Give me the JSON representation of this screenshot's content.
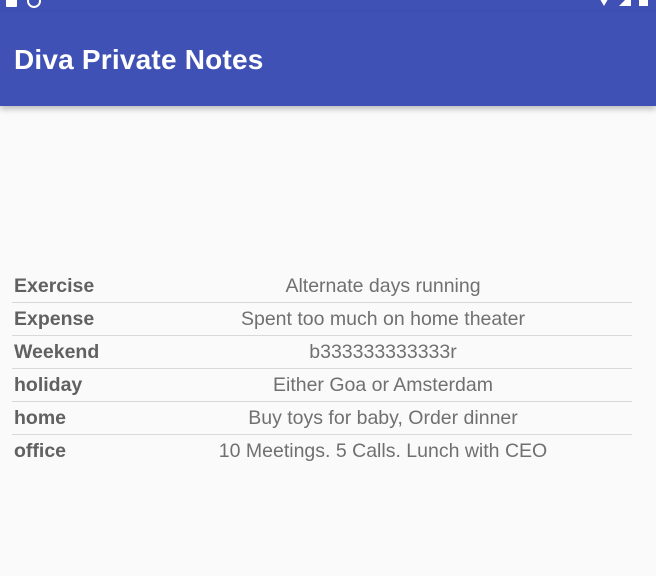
{
  "app": {
    "title": "Diva Private Notes",
    "colors": {
      "app_bar": "#3f51b5",
      "background": "#fafafa",
      "key_text": "#616161",
      "value_text": "#707070",
      "divider": "#d9d9d9"
    }
  },
  "status_bar": {
    "icons": [
      "notification-icon",
      "sync-icon",
      "wifi-icon",
      "signal-icon",
      "battery-icon"
    ]
  },
  "notes": [
    {
      "key": "Exercise",
      "value": "Alternate days running"
    },
    {
      "key": "Expense",
      "value": "Spent too much on home theater"
    },
    {
      "key": "Weekend",
      "value": "b333333333333r"
    },
    {
      "key": "holiday",
      "value": "Either Goa or Amsterdam"
    },
    {
      "key": "home",
      "value": "Buy toys for baby, Order dinner"
    },
    {
      "key": "office",
      "value": "10 Meetings. 5 Calls. Lunch with CEO"
    }
  ]
}
